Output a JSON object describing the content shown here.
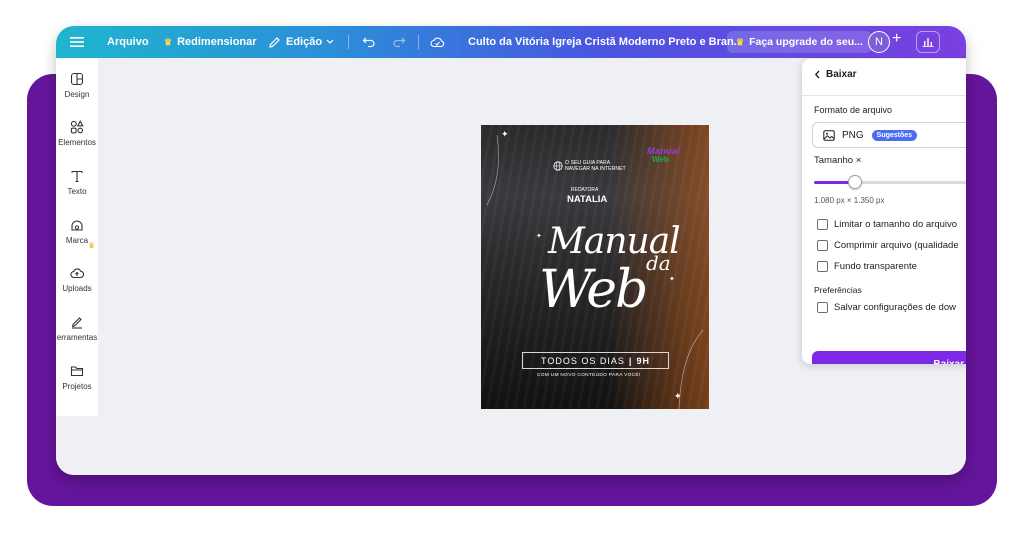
{
  "topbar": {
    "menu": "Arquivo",
    "resize": "Redimensionar",
    "edit": "Edição",
    "doc_title": "Culto da Vitória Igreja Cristã Moderno Preto e Bran...",
    "upgrade": "Faça upgrade do seu...",
    "avatar_initial": "N",
    "plus": "+"
  },
  "sidebar": {
    "items": [
      {
        "label": "Design",
        "icon": "layout-icon"
      },
      {
        "label": "Elementos",
        "icon": "shapes-icon"
      },
      {
        "label": "Texto",
        "icon": "text-icon"
      },
      {
        "label": "Marca",
        "icon": "brand-icon"
      },
      {
        "label": "Uploads",
        "icon": "upload-cloud-icon"
      },
      {
        "label": "erramentas",
        "icon": "pen-icon"
      },
      {
        "label": "Projetos",
        "icon": "folder-icon"
      }
    ]
  },
  "poster": {
    "guide_line1": "O SEU GUIA PARA",
    "guide_line2": "NAVEGAR NA INTERNET",
    "logo_manual": "Manual",
    "logo_web": "Web",
    "redatora": "REDATORA",
    "natalia": "NATALIA",
    "title_manual": "Manual",
    "title_da": "da",
    "title_web": "Web",
    "todos": "TODOS OS DIAS",
    "todos_sep": "|",
    "todos_time": "9H",
    "novo": "COM UM NOVO CONTEÚDO PARA VOCÊ!"
  },
  "download_panel": {
    "back_label": "Baixar",
    "format_label": "Formato de arquivo",
    "format_value": "PNG",
    "format_badge": "Sugestões",
    "size_label": "Tamanho ×",
    "size_slider_fraction": 0.24,
    "dimensions": "1.080 px × 1.350 px",
    "options": [
      {
        "label": "Limitar o tamanho do arquivo",
        "checked": false
      },
      {
        "label": "Comprimir arquivo (qualidade",
        "checked": false
      },
      {
        "label": "Fundo transparente",
        "checked": false
      }
    ],
    "prefs_label": "Preferências",
    "prefs_option": {
      "label": "Salvar configurações de dow",
      "checked": false
    },
    "download_button": "Baixar"
  },
  "colors": {
    "background_purple": "#65159b",
    "accent_purple": "#7d2ae8",
    "badge_blue": "#4b6df2"
  }
}
